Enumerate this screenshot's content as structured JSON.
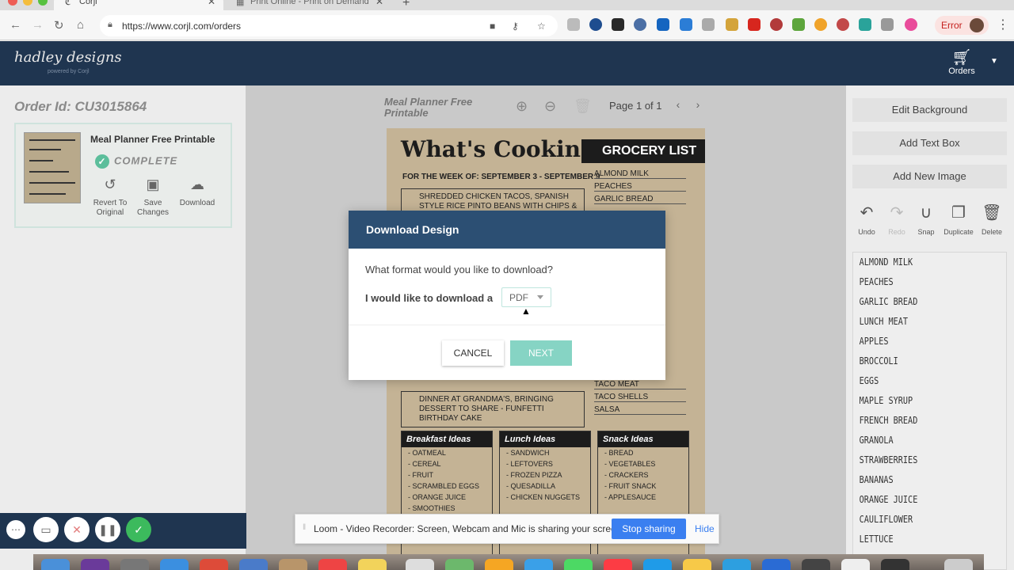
{
  "browser": {
    "tabs": [
      {
        "label": "Corjl",
        "active": true
      },
      {
        "label": "Print Online - Print on Demand",
        "active": false
      }
    ],
    "url": "https://www.corjl.com/orders",
    "error_label": "Error"
  },
  "header": {
    "logo": "hadley designs",
    "logo_sub": "powered by Corjl",
    "orders_label": "Orders"
  },
  "left": {
    "order_id": "Order Id: CU3015864",
    "card": {
      "title": "Meal Planner Free Printable",
      "status": "COMPLETE",
      "actions": [
        {
          "line1": "Revert To",
          "line2": "Original",
          "icon": "revert-icon"
        },
        {
          "line1": "Save",
          "line2": "Changes",
          "icon": "save-icon"
        },
        {
          "line1": "Download",
          "line2": "",
          "icon": "download-icon"
        }
      ]
    }
  },
  "canvas": {
    "title": "Meal Planner Free Printable",
    "page_info": "Page 1 of 1",
    "sheet": {
      "heading": "What's Cooking?",
      "grocery_heading": "GROCERY LIST",
      "week": "FOR THE WEEK OF: SEPTEMBER 3 - SEPTEMBER 9",
      "grocery_items": [
        "ALMOND MILK",
        "PEACHES",
        "GARLIC BREAD"
      ],
      "grocery_items_lower": [
        "TACO MEAT",
        "TACO SHELLS",
        "SALSA"
      ],
      "meal_top": "SHREDDED CHICKEN TACOS, SPANISH STYLE RICE PINTO BEANS WITH CHIPS & SALSA",
      "meal_bottom": "DINNER AT GRANDMA'S, BRINGING DESSERT TO SHARE - FUNFETTI BIRTHDAY CAKE",
      "ideas": [
        {
          "title": "Breakfast Ideas",
          "items": [
            "- OATMEAL",
            "- CEREAL",
            "- FRUIT",
            "- SCRAMBLED EGGS",
            "- ORANGE JUICE",
            "- SMOOTHIES"
          ]
        },
        {
          "title": "Lunch Ideas",
          "items": [
            "- SANDWICH",
            "- LEFTOVERS",
            "- FROZEN PIZZA",
            "- QUESADILLA",
            "- CHICKEN NUGGETS"
          ]
        },
        {
          "title": "Snack Ideas",
          "items": [
            "- BREAD",
            "- VEGETABLES",
            "- CRACKERS",
            "- FRUIT SNACK",
            "- APPLESAUCE"
          ]
        }
      ]
    }
  },
  "modal": {
    "title": "Download Design",
    "question": "What format would you like to download?",
    "label": "I would like to download a",
    "format_value": "PDF",
    "cancel_label": "CANCEL",
    "next_label": "NEXT"
  },
  "right": {
    "buttons": [
      "Edit Background",
      "Add Text Box",
      "Add New Image"
    ],
    "tools": [
      {
        "label": "Undo",
        "icon": "undo-icon",
        "enabled": true
      },
      {
        "label": "Redo",
        "icon": "redo-icon",
        "enabled": false
      },
      {
        "label": "Snap",
        "icon": "snap-icon",
        "enabled": true
      },
      {
        "label": "Duplicate",
        "icon": "duplicate-icon",
        "enabled": true
      },
      {
        "label": "Delete",
        "icon": "delete-icon",
        "enabled": true
      }
    ],
    "items": [
      "ALMOND MILK",
      "PEACHES",
      "GARLIC BREAD",
      "LUNCH MEAT",
      "APPLES",
      "BROCCOLI",
      "EGGS",
      "MAPLE SYRUP",
      "FRENCH BREAD",
      "GRANOLA",
      "STRAWBERRIES",
      "BANANAS",
      "ORANGE JUICE",
      "CAULIFLOWER",
      "LETTUCE"
    ]
  },
  "loom": {
    "message": "Loom - Video Recorder: Screen, Webcam and Mic is sharing your screen.",
    "stop_label": "Stop sharing",
    "hide_label": "Hide"
  },
  "colors": {
    "header_bg": "#1f3550",
    "modal_header": "#2c4f73",
    "accent_green": "#5cbe9b",
    "next_button": "#86d4c4",
    "loom_blue": "#3a7ff0"
  }
}
